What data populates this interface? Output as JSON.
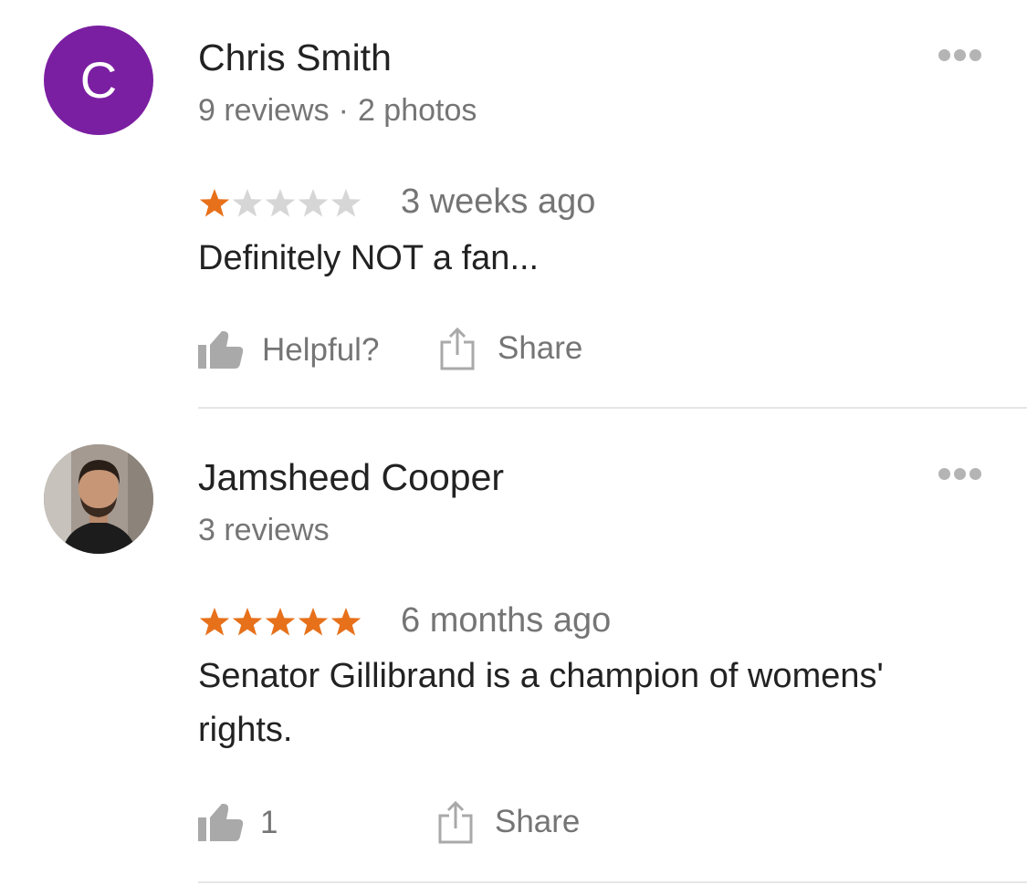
{
  "colors": {
    "star_filled": "#e7711b",
    "star_empty": "#d6d6d6",
    "icon_gray": "#a9a9a9",
    "avatar_purple": "#7b1fa2"
  },
  "reviews": [
    {
      "avatar_letter": "C",
      "author": "Chris Smith",
      "review_count": "9 reviews",
      "separator": "·",
      "photo_count": "2 photos",
      "rating": 1,
      "max_rating": 5,
      "time": "3 weeks ago",
      "text": "Definitely NOT a fan...",
      "helpful_label": "Helpful?",
      "share_label": "Share",
      "more_icon": "more-options-icon"
    },
    {
      "avatar_letter": "",
      "author": "Jamsheed Cooper",
      "review_count": "3 reviews",
      "rating": 5,
      "max_rating": 5,
      "time": "6 months ago",
      "text": "Senator Gillibrand is a champion of womens' rights.",
      "helpful_count": "1",
      "share_label": "Share",
      "more_icon": "more-options-icon"
    }
  ]
}
